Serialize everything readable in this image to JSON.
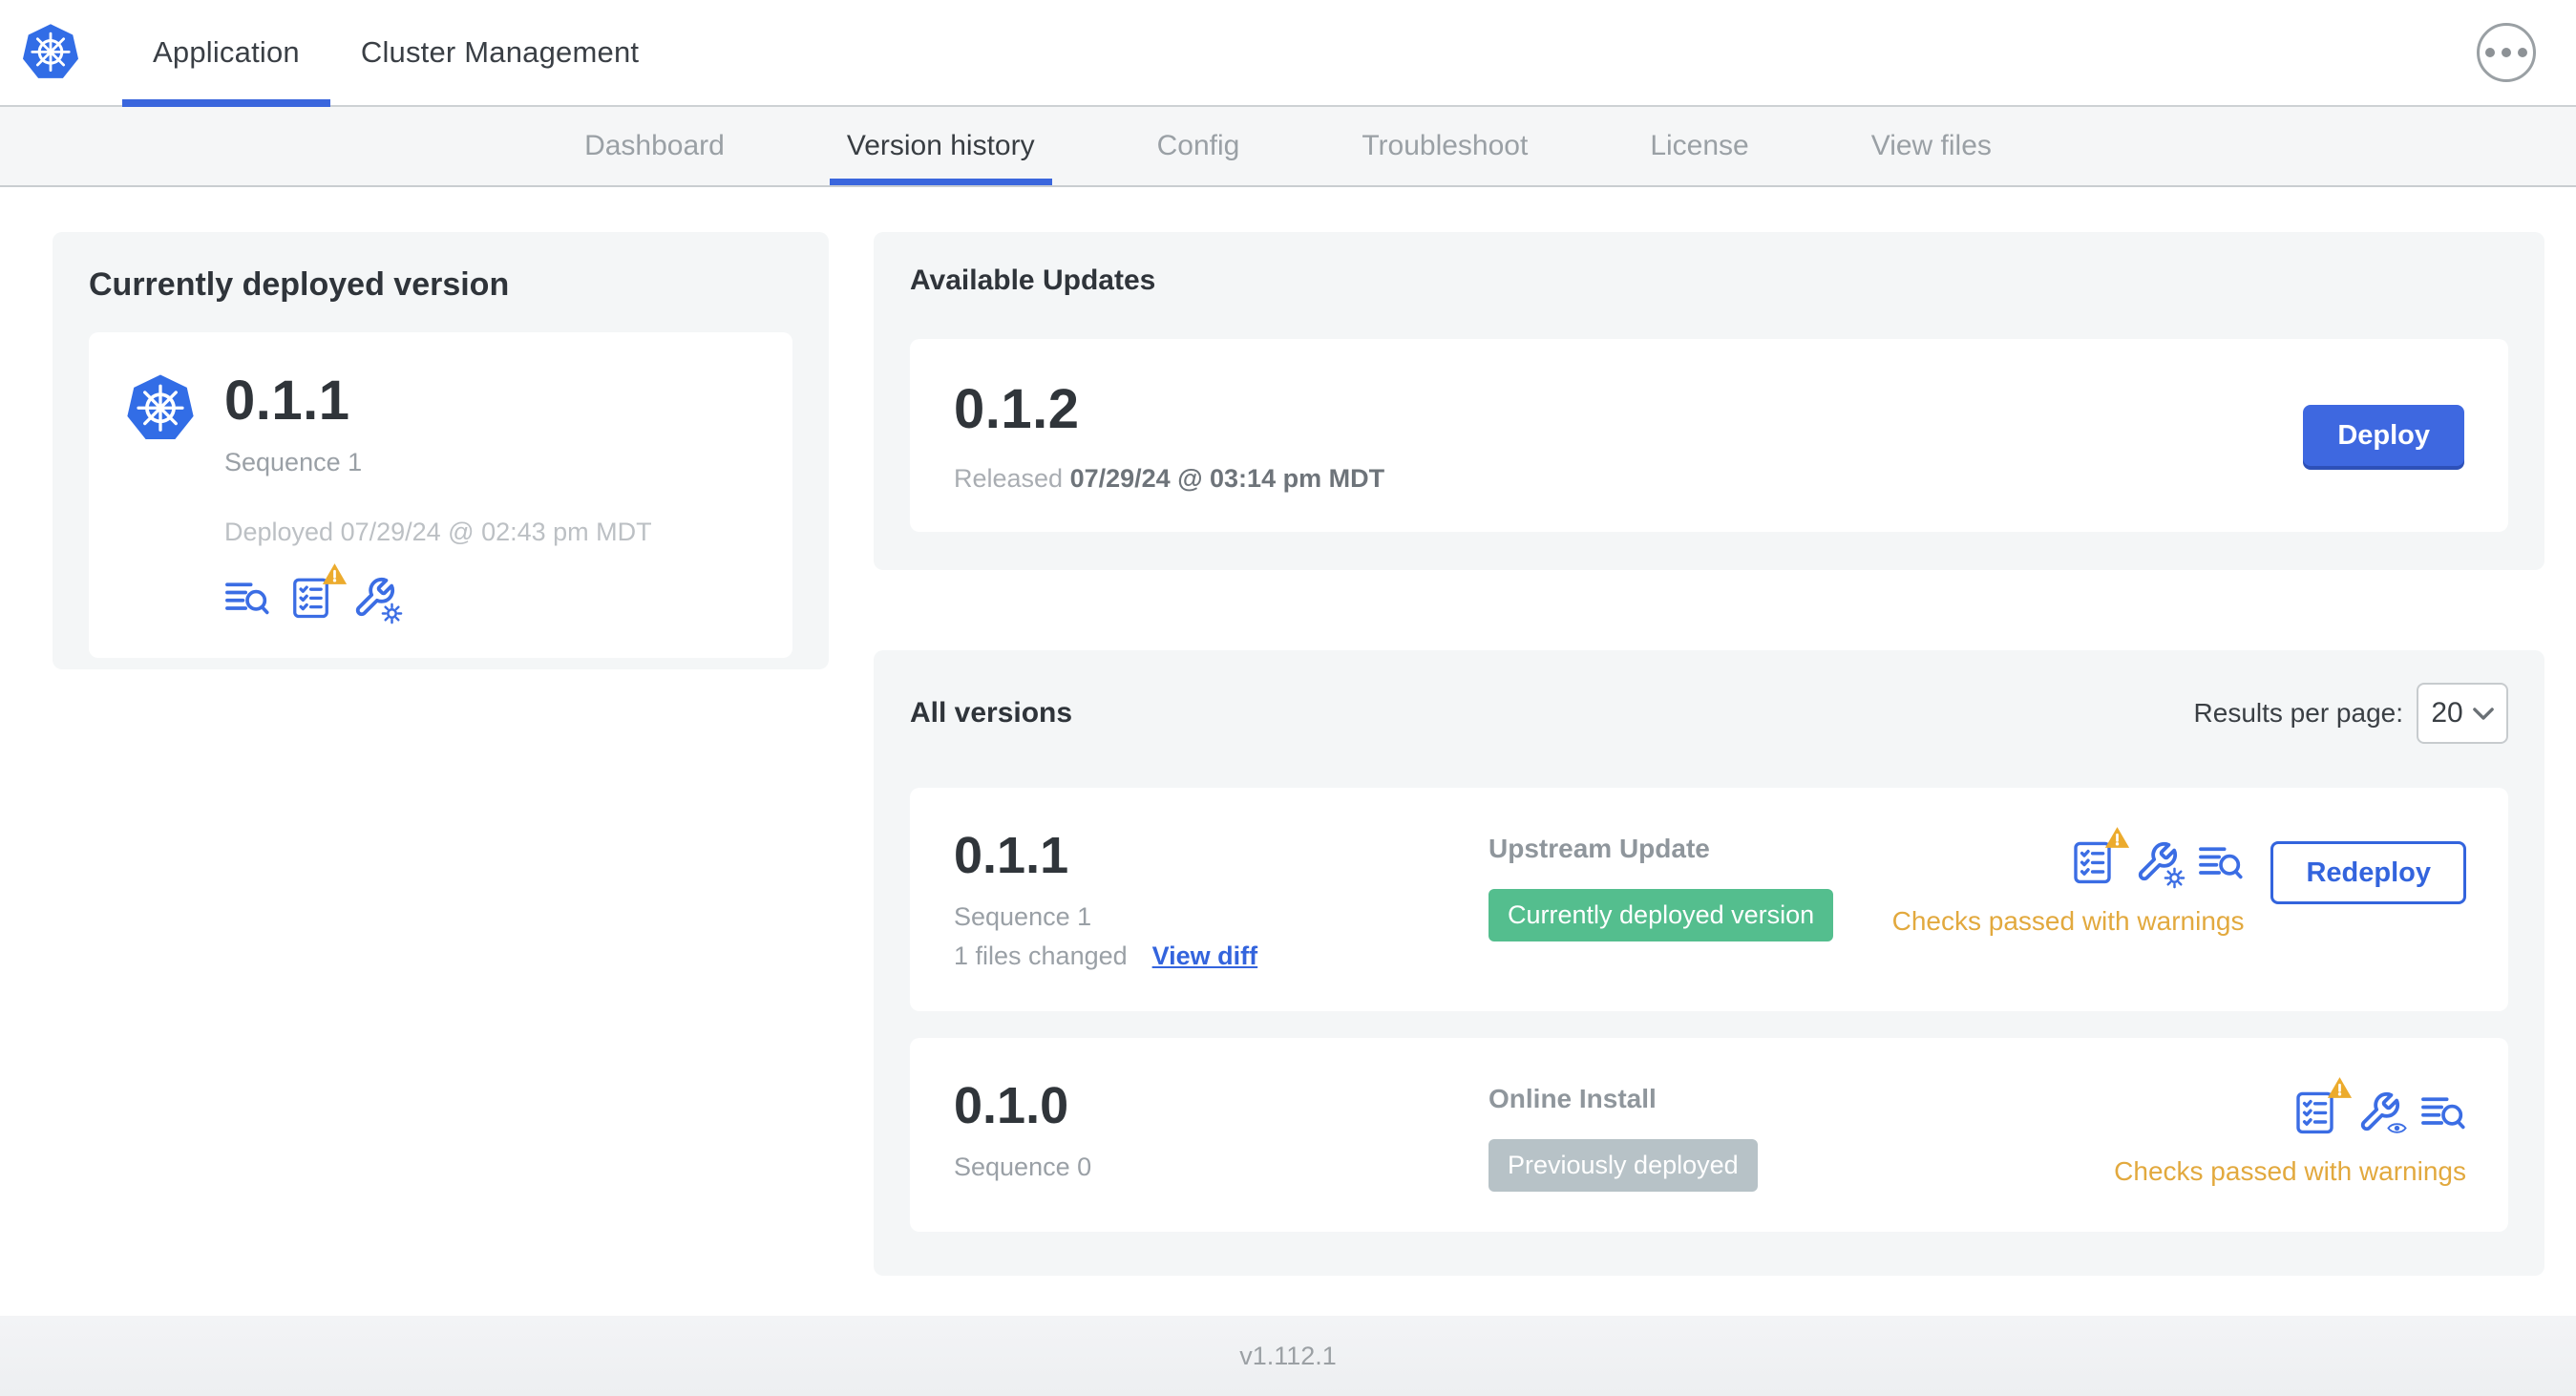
{
  "topnav": {
    "logo_icon": "kubernetes-logo",
    "tabs": [
      {
        "label": "Application",
        "active": true
      },
      {
        "label": "Cluster Management",
        "active": false
      }
    ],
    "more_menu_icon": "ellipsis-icon"
  },
  "subnav": {
    "tabs": [
      {
        "label": "Dashboard",
        "active": false
      },
      {
        "label": "Version history",
        "active": true
      },
      {
        "label": "Config",
        "active": false
      },
      {
        "label": "Troubleshoot",
        "active": false
      },
      {
        "label": "License",
        "active": false
      },
      {
        "label": "View files",
        "active": false
      }
    ]
  },
  "current_version": {
    "title": "Currently deployed version",
    "version": "0.1.1",
    "sequence": "Sequence 1",
    "deployed": "Deployed 07/29/24 @ 02:43 pm MDT",
    "icons": [
      "deploy-logs-icon",
      "preflight-checks-warning-icon",
      "edit-config-icon"
    ]
  },
  "available_updates": {
    "title": "Available Updates",
    "version": "0.1.2",
    "released_prefix": "Released",
    "released_date": "07/29/24 @ 03:14 pm MDT",
    "deploy_label": "Deploy"
  },
  "all_versions": {
    "title": "All versions",
    "results_per_page_label": "Results per page:",
    "results_per_page_value": "20",
    "rows": [
      {
        "version": "0.1.1",
        "sequence": "Sequence 1",
        "files_changed": "1 files changed",
        "view_diff_label": "View diff",
        "source": "Upstream Update",
        "badge": "Currently deployed version",
        "badge_style": "green",
        "icons": [
          "preflight-checks-warning-icon",
          "edit-config-icon",
          "deploy-logs-icon"
        ],
        "checks": "Checks passed with warnings",
        "action_label": "Redeploy"
      },
      {
        "version": "0.1.0",
        "sequence": "Sequence 0",
        "source": "Online Install",
        "badge": "Previously deployed",
        "badge_style": "gray",
        "icons": [
          "preflight-checks-warning-icon",
          "view-config-icon",
          "deploy-logs-icon"
        ],
        "checks": "Checks passed with warnings"
      }
    ]
  },
  "footer": {
    "version": "v1.112.1"
  },
  "colors": {
    "primary_blue": "#3364dd",
    "deploy_button_blue": "#3e68e0",
    "badge_green": "#54be8e",
    "badge_gray": "#b7c2c7",
    "warning_orange": "#e2a93e",
    "warning_triangle": "#ecab2d"
  }
}
